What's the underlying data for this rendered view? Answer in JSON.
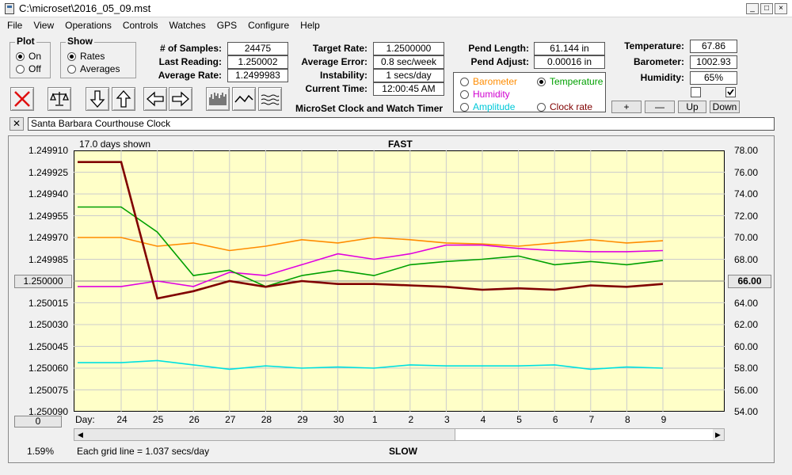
{
  "window": {
    "title": "C:\\microset\\2016_05_09.mst",
    "min_label": "_",
    "max_label": "□",
    "close_label": "×"
  },
  "menu": [
    "File",
    "View",
    "Operations",
    "Controls",
    "Watches",
    "GPS",
    "Configure",
    "Help"
  ],
  "plot_group": {
    "label": "Plot",
    "on_label": "On",
    "off_label": "Off",
    "selected": "On"
  },
  "show_group": {
    "label": "Show",
    "rates_label": "Rates",
    "averages_label": "Averages",
    "selected": "Rates"
  },
  "stats": {
    "samples_label": "# of Samples:",
    "samples": "24475",
    "last_label": "Last Reading:",
    "last": "1.250002",
    "avg_rate_label": "Average Rate:",
    "avg_rate": "1.2499983"
  },
  "targets": {
    "target_label": "Target Rate:",
    "target": "1.2500000",
    "avg_err_label": "Average Error:",
    "avg_err": "0.8 sec/week",
    "instab_label": "Instability:",
    "instab": "1 secs/day",
    "time_label": "Current Time:",
    "time": "12:00:45 AM",
    "app_caption": "MicroSet Clock and Watch Timer"
  },
  "pend": {
    "length_label": "Pend Length:",
    "length": "61.144 in",
    "adjust_label": "Pend Adjust:",
    "adjust": "0.00016 in"
  },
  "series_select": {
    "barometer": "Barometer",
    "temperature": "Temperature",
    "humidity": "Humidity",
    "amplitude": "Amplitude",
    "clock_rate": "Clock rate",
    "selected": "Temperature"
  },
  "env": {
    "temp_label": "Temperature:",
    "temp": "67.86",
    "baro_label": "Barometer:",
    "baro": "1002.93",
    "humid_label": "Humidity:",
    "humid": "65%"
  },
  "adjust_buttons": {
    "plus": "+",
    "minus": "—",
    "up": "Up",
    "down": "Down"
  },
  "clock_name": {
    "close": "✕",
    "value": "Santa Barbara Courthouse Clock"
  },
  "plot": {
    "days_shown": "17.0 days shown",
    "top_label": "FAST",
    "bottom_label": "SLOW",
    "grid_note": "Each grid line = 1.037 secs/day",
    "zoom_pct": "1.59%",
    "left_btn": "1.250000",
    "right_btn": "66.00",
    "bottom_left_btn": "0",
    "day_label": "Day:",
    "left_ticks": [
      "1.249910",
      "1.249925",
      "1.249940",
      "1.249955",
      "1.249970",
      "1.249985",
      "1.250000",
      "1.250015",
      "1.250030",
      "1.250045",
      "1.250060",
      "1.250075",
      "1.250090"
    ],
    "right_ticks": [
      "78.00",
      "76.00",
      "74.00",
      "72.00",
      "70.00",
      "68.00",
      "66.00",
      "64.00",
      "62.00",
      "60.00",
      "58.00",
      "56.00",
      "54.00"
    ],
    "x_ticks": [
      "24",
      "25",
      "26",
      "27",
      "28",
      "29",
      "30",
      "1",
      "2",
      "3",
      "4",
      "5",
      "6",
      "7",
      "8",
      "9"
    ],
    "colors": {
      "rate": "#800000",
      "temperature": "#00a000",
      "barometer": "#ff8c00",
      "humidity": "#e000e0",
      "amplitude": "#00e0e0",
      "bg": "#ffffc8"
    }
  },
  "chart_data": {
    "type": "line",
    "title": "",
    "xlabel": "Day",
    "ylabel": "",
    "x": [
      "24",
      "25",
      "26",
      "27",
      "28",
      "29",
      "30",
      "1",
      "2",
      "3",
      "4",
      "5",
      "6",
      "7",
      "8",
      "9"
    ],
    "ylim": [
      1.25009,
      1.24991
    ],
    "y2lim": [
      54,
      78
    ],
    "series": [
      {
        "name": "Clock rate",
        "axis": "left",
        "values": [
          1.249918,
          1.250012,
          1.250007,
          1.25,
          1.250004,
          1.25,
          1.250002,
          1.250002,
          1.250003,
          1.250004,
          1.250006,
          1.250005,
          1.250006,
          1.250003,
          1.250004,
          1.250002
        ]
      },
      {
        "name": "Temperature",
        "axis": "right",
        "values": [
          72.8,
          70.5,
          66.5,
          67.0,
          65.5,
          66.5,
          67.0,
          66.5,
          67.5,
          67.8,
          68.0,
          68.3,
          67.5,
          67.8,
          67.5,
          67.9
        ]
      },
      {
        "name": "Barometer",
        "axis": "right",
        "values": [
          70.0,
          69.2,
          69.5,
          68.8,
          69.2,
          69.8,
          69.5,
          70.0,
          69.8,
          69.5,
          69.4,
          69.2,
          69.5,
          69.8,
          69.5,
          69.7
        ]
      },
      {
        "name": "Humidity",
        "axis": "right",
        "values": [
          65.5,
          66.0,
          65.5,
          66.8,
          66.5,
          67.5,
          68.5,
          68.0,
          68.5,
          69.3,
          69.3,
          69.0,
          68.8,
          68.7,
          68.7,
          68.8
        ]
      },
      {
        "name": "Amplitude",
        "axis": "right",
        "values": [
          58.5,
          58.7,
          58.3,
          57.9,
          58.2,
          58.0,
          58.1,
          58.0,
          58.3,
          58.2,
          58.2,
          58.2,
          58.3,
          57.9,
          58.1,
          58.0
        ]
      }
    ]
  }
}
